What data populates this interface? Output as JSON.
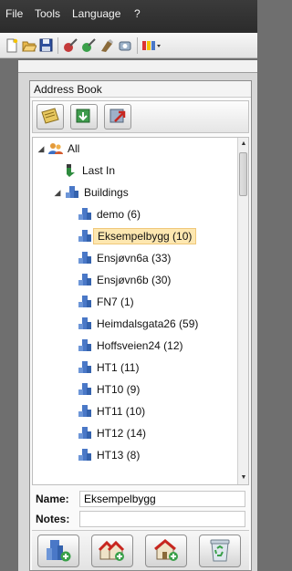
{
  "menubar": {
    "items": [
      "File",
      "Tools",
      "Language",
      "?"
    ]
  },
  "toolbar": {
    "icons": [
      "new-icon",
      "open-icon",
      "save-icon",
      "tool-1-icon",
      "tool-2-icon",
      "tool-3-icon",
      "tool-4-icon",
      "colors-icon"
    ]
  },
  "address_book": {
    "title": "Address Book",
    "toolbar": [
      "contact-card-icon",
      "import-icon",
      "export-icon"
    ],
    "tree": {
      "root": "All",
      "last_in": "Last In",
      "group": "Buildings",
      "items": [
        "demo (6)",
        "Eksempelbygg (10)",
        "Ensjøvn6a (33)",
        "Ensjøvn6b (30)",
        "FN7 (1)",
        "Heimdalsgata26 (59)",
        "Hoffsveien24 (12)",
        "HT1 (11)",
        "HT10 (9)",
        "HT11 (10)",
        "HT12 (14)",
        "HT13 (8)"
      ],
      "selected": "Eksempelbygg (10)"
    },
    "name": {
      "label": "Name:",
      "value": "Eksempelbygg"
    },
    "notes": {
      "label": "Notes:",
      "value": ""
    },
    "bottom_buttons": [
      "add-building-icon",
      "add-houses-icon",
      "add-house-icon",
      "recycle-bin-icon"
    ]
  },
  "colors": {
    "menubar": "#2f2f2f",
    "selection": "#fde7b0",
    "building_icon": "#4a78c7"
  }
}
